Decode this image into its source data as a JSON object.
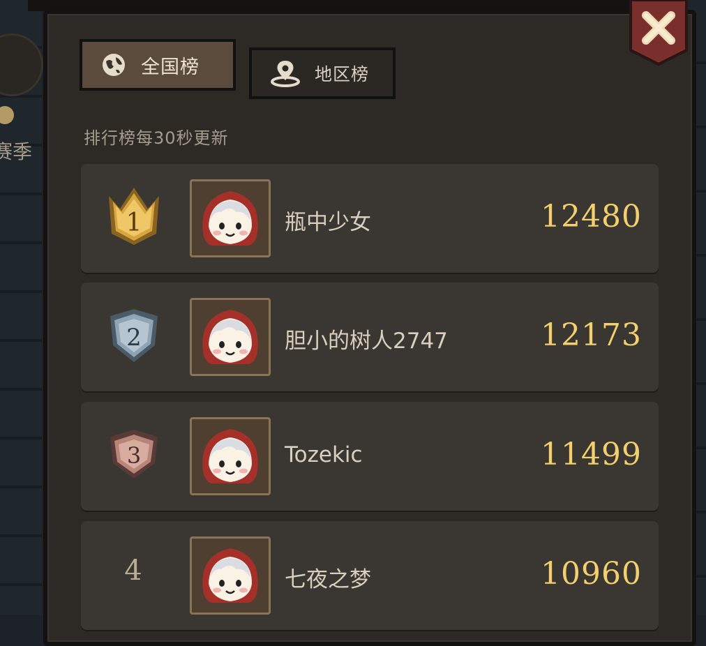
{
  "side": {
    "label": "赛季"
  },
  "tabs": [
    {
      "label": "全国榜",
      "icon": "globe-icon",
      "active": true
    },
    {
      "label": "地区榜",
      "icon": "location-pin-icon",
      "active": false
    }
  ],
  "notice": "排行榜每30秒更新",
  "colors": {
    "score": "#f3cf6e",
    "gold": "#d6a640",
    "silver": "#8fa4b4",
    "bronze": "#b8857a"
  },
  "leaderboard": [
    {
      "rank": "1",
      "name": "瓶中少女",
      "score": "12480",
      "badge": "gold-crown-badge-icon"
    },
    {
      "rank": "2",
      "name": "胆小的树人2747",
      "score": "12173",
      "badge": "silver-shield-badge-icon"
    },
    {
      "rank": "3",
      "name": "Tozekic",
      "score": "11499",
      "badge": "bronze-shield-badge-icon"
    },
    {
      "rank": "4",
      "name": "七夜之梦",
      "score": "10960",
      "badge": ""
    }
  ]
}
